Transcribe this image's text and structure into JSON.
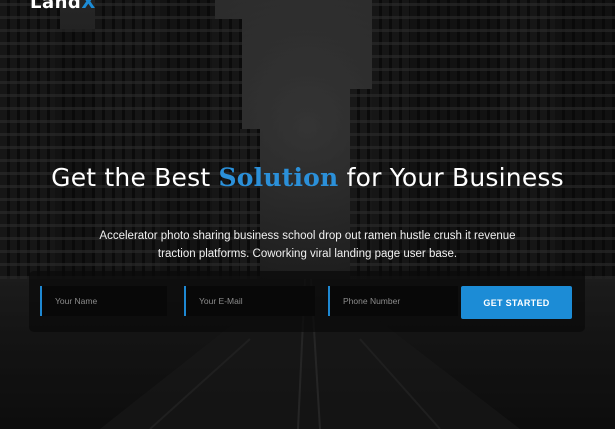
{
  "brand": {
    "logo_main": "Land",
    "logo_accent": "X"
  },
  "hero": {
    "headline_before": "Get the Best ",
    "headline_accent": "Solution",
    "headline_after": " for Your Business",
    "subtext": "Accelerator photo sharing business school drop out ramen hustle crush it revenue traction platforms. Coworking viral landing page user base."
  },
  "form": {
    "name_placeholder": "Your Name",
    "email_placeholder": "Your E-Mail",
    "phone_placeholder": "Phone Number",
    "submit_label": "GET STARTED"
  },
  "colors": {
    "accent": "#1c8cd6",
    "headline_accent": "#2b90d9",
    "form_background": "#0a0a0a"
  }
}
